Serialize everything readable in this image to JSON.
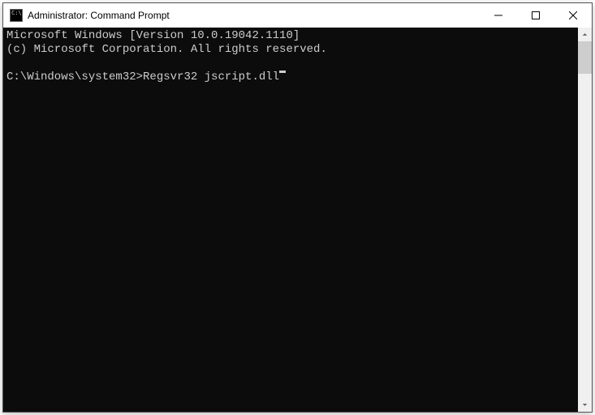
{
  "titlebar": {
    "title": "Administrator: Command Prompt"
  },
  "terminal": {
    "line1": "Microsoft Windows [Version 10.0.19042.1110]",
    "line2": "(c) Microsoft Corporation. All rights reserved.",
    "blank": "",
    "prompt": "C:\\Windows\\system32>",
    "command": "Regsvr32 jscript.dll"
  }
}
